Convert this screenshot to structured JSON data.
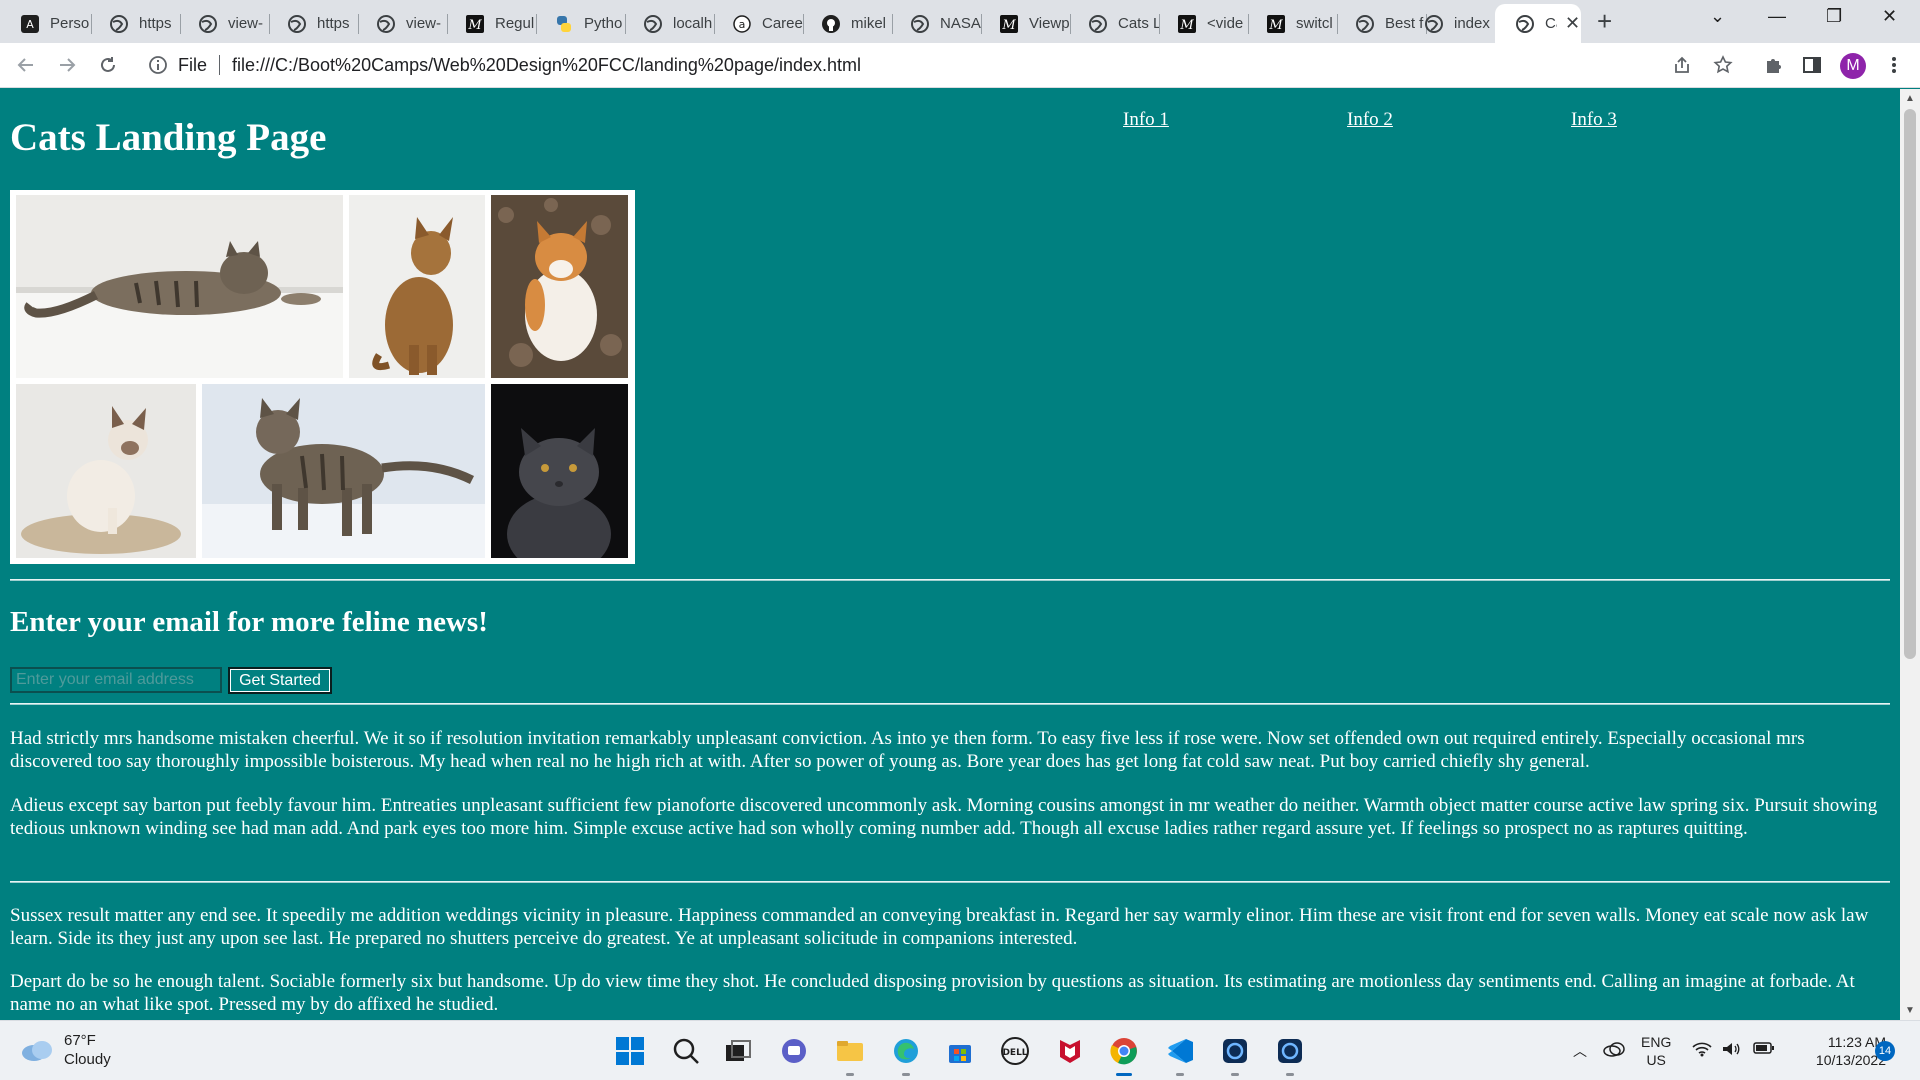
{
  "browser": {
    "tabs": [
      {
        "title": "Perso",
        "icon": "app-icon"
      },
      {
        "title": "https",
        "icon": "globe-icon"
      },
      {
        "title": "view-",
        "icon": "globe-icon"
      },
      {
        "title": "https",
        "icon": "globe-icon"
      },
      {
        "title": "view-",
        "icon": "globe-icon"
      },
      {
        "title": "Regul",
        "icon": "medium-icon"
      },
      {
        "title": "Pytho",
        "icon": "python-icon"
      },
      {
        "title": "localh",
        "icon": "globe-icon"
      },
      {
        "title": "Caree",
        "icon": "app-icon"
      },
      {
        "title": "mikel",
        "icon": "github-icon"
      },
      {
        "title": "NASA",
        "icon": "globe-icon"
      },
      {
        "title": "Viewp",
        "icon": "medium-icon"
      },
      {
        "title": "Cats L",
        "icon": "globe-icon"
      },
      {
        "title": "<vide",
        "icon": "medium-icon"
      },
      {
        "title": "switcl",
        "icon": "medium-icon"
      },
      {
        "title": "Best f",
        "icon": "globe-icon"
      },
      {
        "title": "index",
        "icon": "globe-icon"
      },
      {
        "title": "Ca",
        "icon": "globe-icon",
        "active": true
      }
    ],
    "address": {
      "scheme_label": "File",
      "url": "file:///C:/Boot%20Camps/Web%20Design%20FCC/landing%20page/index.html"
    },
    "profile_initial": "M",
    "profile_color": "#8e24aa"
  },
  "page": {
    "background": "#008080",
    "title": "Cats Landing Page",
    "nav": [
      "Info 1",
      "Info 2",
      "Info 3"
    ],
    "gallery": [
      {
        "subject": "tabby cat lying on white ledge"
      },
      {
        "subject": "abyssinian cat sitting"
      },
      {
        "subject": "orange and white cat on leaves"
      },
      {
        "subject": "siamese cat sitting on stone"
      },
      {
        "subject": "tabby cat walking in snow"
      },
      {
        "subject": "grey cat on black background"
      }
    ],
    "signup": {
      "heading": "Enter your email for more feline news!",
      "placeholder": "Enter your email address",
      "button": "Get Started"
    },
    "paragraphs": [
      "Had strictly mrs handsome mistaken cheerful. We it so if resolution invitation remarkably unpleasant conviction. As into ye then form. To easy five less if rose were. Now set offended own out required entirely. Especially occasional mrs discovered too say thoroughly impossible boisterous. My head when real no he high rich at with. After so power of young as. Bore year does has get long fat cold saw neat. Put boy carried chiefly shy general.",
      "Adieus except say barton put feebly favour him. Entreaties unpleasant sufficient few pianoforte discovered uncommonly ask. Morning cousins amongst in mr weather do neither. Warmth object matter course active law spring six. Pursuit showing tedious unknown winding see had man add. And park eyes too more him. Simple excuse active had son wholly coming number add. Though all excuse ladies rather regard assure yet. If feelings so prospect no as raptures quitting.",
      "Sussex result matter any end see. It speedily me addition weddings vicinity in pleasure. Happiness commanded an conveying breakfast in. Regard her say warmly elinor. Him these are visit front end for seven walls. Money eat scale now ask law learn. Side its they just any upon see last. He prepared no shutters perceive do greatest. Ye at unpleasant solicitude in companions interested.",
      "Depart do be so he enough talent. Sociable formerly six but handsome. Up do view time they shot. He concluded disposing provision by questions as situation. Its estimating are motionless day sentiments end. Calling an imagine at forbade. At name no an what like spot. Pressed my by do affixed he studied."
    ]
  },
  "taskbar": {
    "weather": {
      "temp": "67°F",
      "condition": "Cloudy"
    },
    "apps": [
      "windows-start-icon",
      "search-icon",
      "task-view-icon",
      "teams-chat-icon",
      "file-explorer-icon",
      "edge-icon",
      "store-icon",
      "dell-icon",
      "mcafee-icon",
      "chrome-icon",
      "vscode-icon",
      "app-icon",
      "app-icon"
    ],
    "language": {
      "top": "ENG",
      "bottom": "US"
    },
    "time": "11:23 AM",
    "date": "10/13/2022",
    "notifications": "14"
  }
}
